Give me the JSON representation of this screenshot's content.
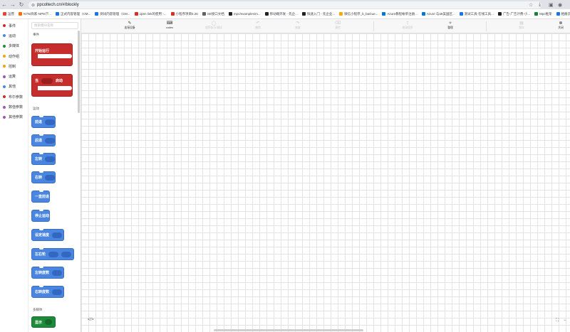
{
  "browser": {
    "url": "ppcoltech.cn/#/blockly",
    "bookmarks": [
      {
        "label": "运营",
        "color": "#ea4335"
      },
      {
        "label": "N7N/商家-NPM下...",
        "color": "#ff6f00"
      },
      {
        "label": "正式内容管理（CM...",
        "color": "#1a73e8"
      },
      {
        "label": "测试内容管理（CM...",
        "color": "#1a73e8"
      },
      {
        "label": "open link的使用 -...",
        "color": "#d93025"
      },
      {
        "label": "小程序项目5.26",
        "color": "#d93025"
      },
      {
        "label": "SE接口文档",
        "color": "#5f6368"
      },
      {
        "label": "mpc/examples/m...",
        "color": "#202124"
      },
      {
        "label": "移动端开发 - 先企...",
        "color": "#202124"
      },
      {
        "label": "快速入门 - 先企业...",
        "color": "#202124"
      },
      {
        "label": "微信小程序_b_baGue...",
        "color": "#f9ab00"
      },
      {
        "label": "Azure教程帐单注册...",
        "color": "#0078d4"
      },
      {
        "label": "Azure 与a8美国区...",
        "color": "#0078d4"
      },
      {
        "label": "测试工具-在线工具...",
        "color": "#1a73e8"
      },
      {
        "label": "广告-广告计费-小...",
        "color": "#202124"
      },
      {
        "label": "Mpc框架",
        "color": "#188038"
      },
      {
        "label": "相册云",
        "color": "#1a73e8"
      }
    ]
  },
  "categories": [
    {
      "label": "事件",
      "color": "#c62e2e"
    },
    {
      "label": "运动",
      "color": "#4a86e0"
    },
    {
      "label": "多媒体",
      "color": "#1e8b3a"
    },
    {
      "label": "动作组",
      "color": "#f2a20c"
    },
    {
      "label": "控制",
      "color": "#f2a20c"
    },
    {
      "label": "运算",
      "color": "#9b59b6"
    },
    {
      "label": "其他",
      "color": "#4a86e0"
    },
    {
      "label": "布尔参数",
      "color": "#c62e2e"
    },
    {
      "label": "数值参数",
      "color": "#9b59b6"
    },
    {
      "label": "其他参数",
      "color": "#9b59b6"
    }
  ],
  "flyout": {
    "search_placeholder": "搜索模块名称",
    "section_events": "事件",
    "section_motion": "运动",
    "section_media": "多媒体",
    "event_blocks": {
      "start": "开始运行",
      "when_prefix": "当",
      "when_suffix": "启动"
    },
    "motion_blocks": [
      "前进",
      "后退",
      "左转",
      "右转",
      "一直前进",
      "停止运动",
      "设定速度",
      "左右轮",
      "左转度数",
      "右转度数"
    ],
    "media_blocks": [
      "显示"
    ]
  },
  "toolbar": {
    "connect": "连接设备",
    "code": "codes",
    "run": "程序执行/调试",
    "undo": "撤销",
    "redo": "恢复",
    "clear": "清空",
    "flash": "烧录程序",
    "tidy": "整理",
    "save": "保存",
    "close": "关闭"
  },
  "workspace": {
    "code_toggle": "</>",
    "fit": "⛶",
    "zoom": "−"
  }
}
